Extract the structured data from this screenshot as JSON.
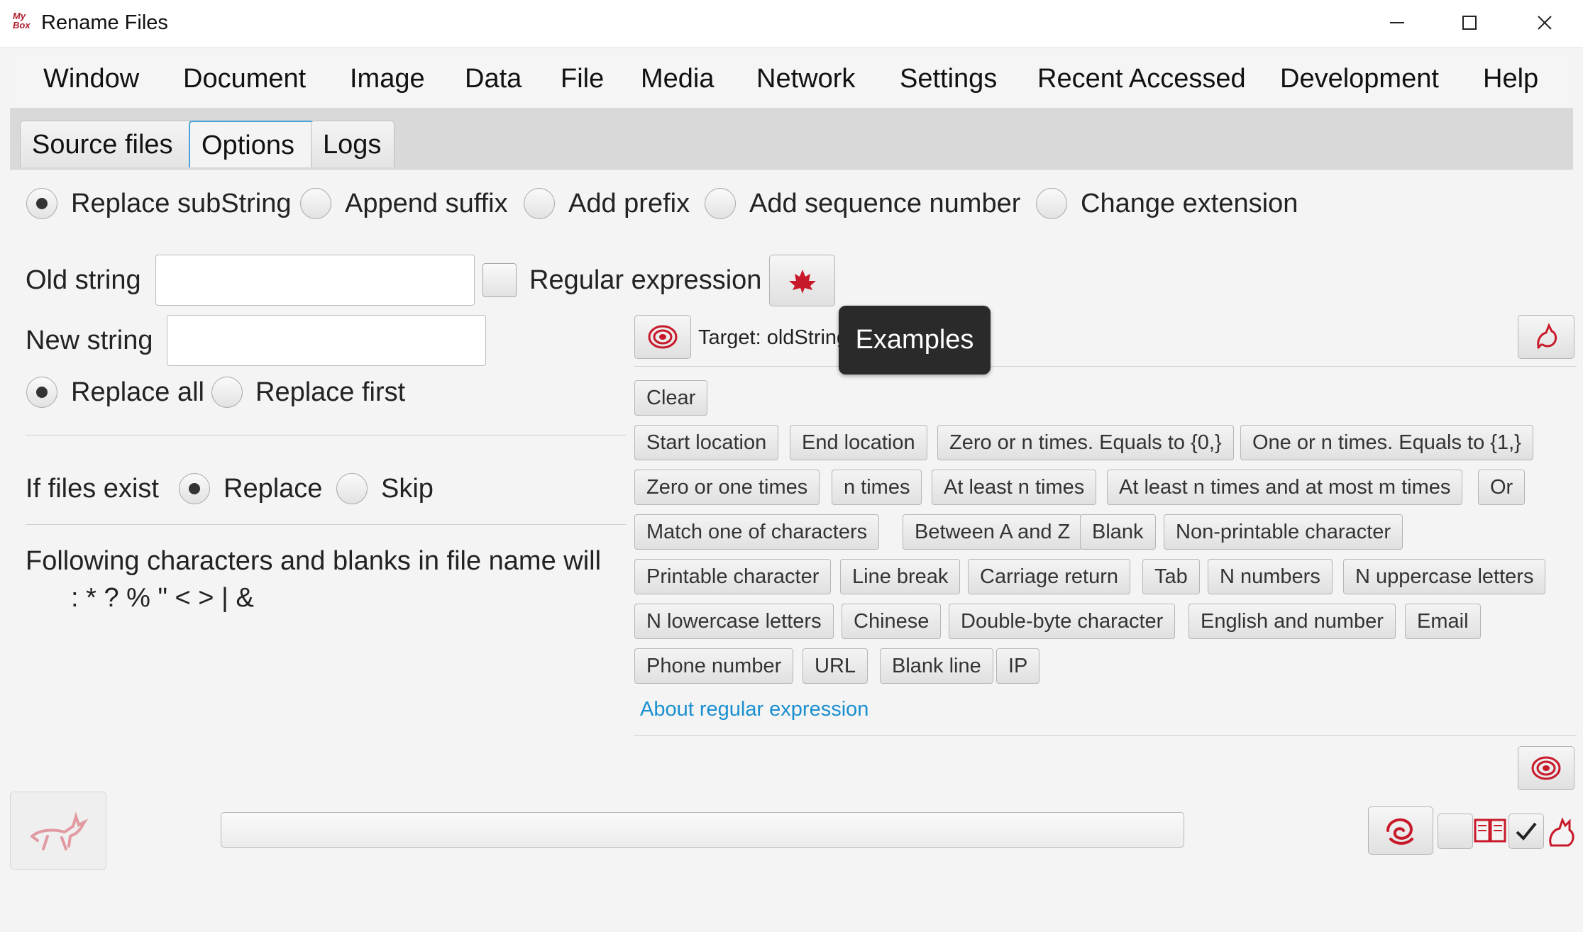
{
  "window": {
    "logo_text": "My Box",
    "title": "Rename Files",
    "controls": [
      "—",
      "☐",
      "✕"
    ]
  },
  "menu": [
    "Window",
    "Document",
    "Image",
    "Data",
    "File",
    "Media",
    "Network",
    "Settings",
    "Recent Accessed",
    "Development",
    "Help"
  ],
  "tabs": [
    {
      "label": "Source files",
      "selected": false
    },
    {
      "label": "Options",
      "selected": true
    },
    {
      "label": "Logs",
      "selected": false
    }
  ],
  "rename_mode": {
    "options": [
      "Replace subString",
      "Append suffix",
      "Add prefix",
      "Add sequence number",
      "Change extension"
    ],
    "selected": "Replace subString"
  },
  "old_string": {
    "label": "Old string",
    "value": ""
  },
  "regex_checkbox": {
    "label": "Regular expression",
    "checked": false
  },
  "new_string": {
    "label": "New string",
    "value": ""
  },
  "replace_scope": {
    "options": [
      "Replace all",
      "Replace first"
    ],
    "selected": "Replace all"
  },
  "files_exist": {
    "label": "If files exist",
    "options": [
      "Replace",
      "Skip"
    ],
    "selected": "Replace"
  },
  "note": {
    "line1": "Following characters and blanks in file name will",
    "line2": ": * ? % \" < > | &"
  },
  "regex_panel": {
    "target_text": "Target: oldString",
    "tooltip": "Examples",
    "clear_label": "Clear",
    "rows": [
      [
        "Start location",
        "End location",
        "Zero or n times. Equals to {0,}",
        "One or n times. Equals to {1,}"
      ],
      [
        "Zero or one times",
        "n times",
        "At least n times",
        "At least n times and at most m times",
        "Or"
      ],
      [
        "Match one of characters",
        "Between A and Z",
        "Blank",
        "Non-printable character"
      ],
      [
        "Printable character",
        "Line break",
        "Carriage return",
        "Tab",
        "N numbers",
        "N uppercase letters"
      ],
      [
        "N lowercase letters",
        "Chinese",
        "Double-byte character",
        "English and number",
        "Email"
      ],
      [
        "Phone number",
        "URL",
        "Blank line",
        "IP"
      ]
    ],
    "about_link": "About regular expression"
  },
  "progress": {
    "value": 0
  },
  "colors": {
    "accent": "#b01e2e",
    "link": "#1a8fd0",
    "tab_focus": "#4aa3d8"
  }
}
